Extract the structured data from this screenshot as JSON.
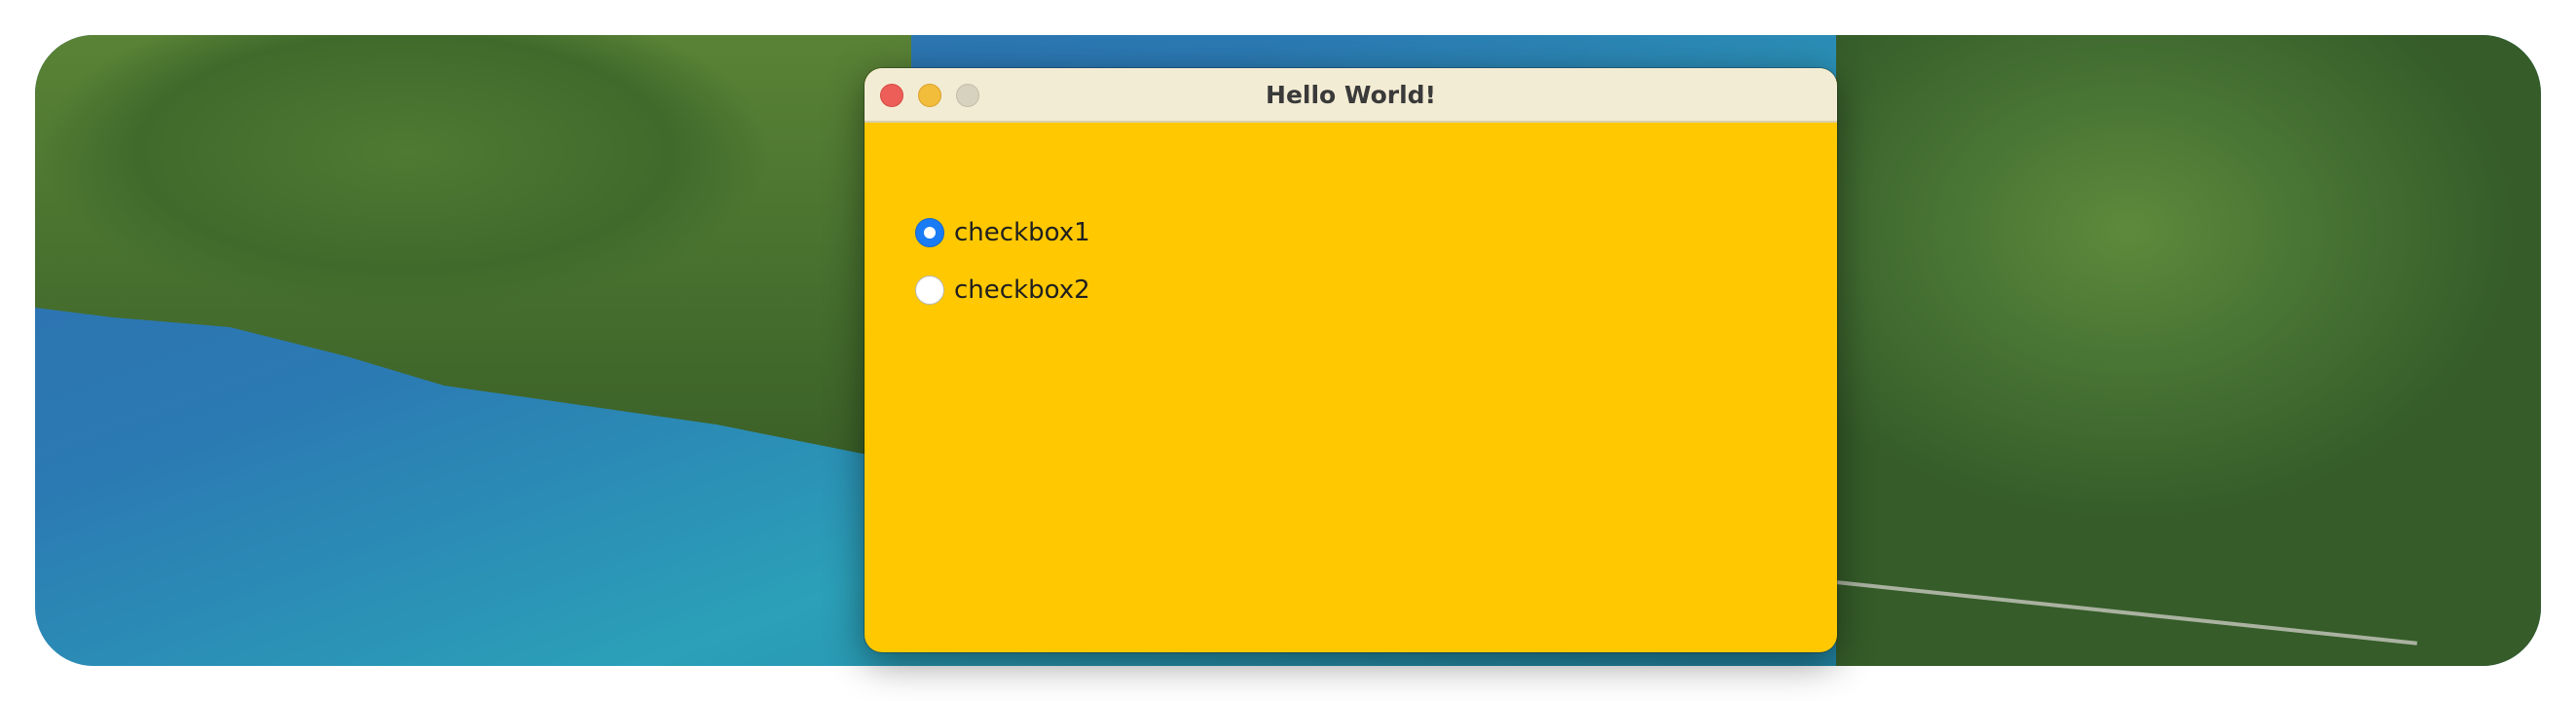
{
  "window": {
    "title": "Hello World!",
    "background_color": "#ffc800",
    "titlebar_color": "#f3ecd4"
  },
  "traffic_lights": {
    "close_color": "#ee5e58",
    "minimize_color": "#f3bd3c",
    "maximize_color": "#d7d2c0"
  },
  "options": [
    {
      "label": "checkbox1",
      "selected": true
    },
    {
      "label": "checkbox2",
      "selected": false
    }
  ],
  "accent_color": "#1a7cf5"
}
